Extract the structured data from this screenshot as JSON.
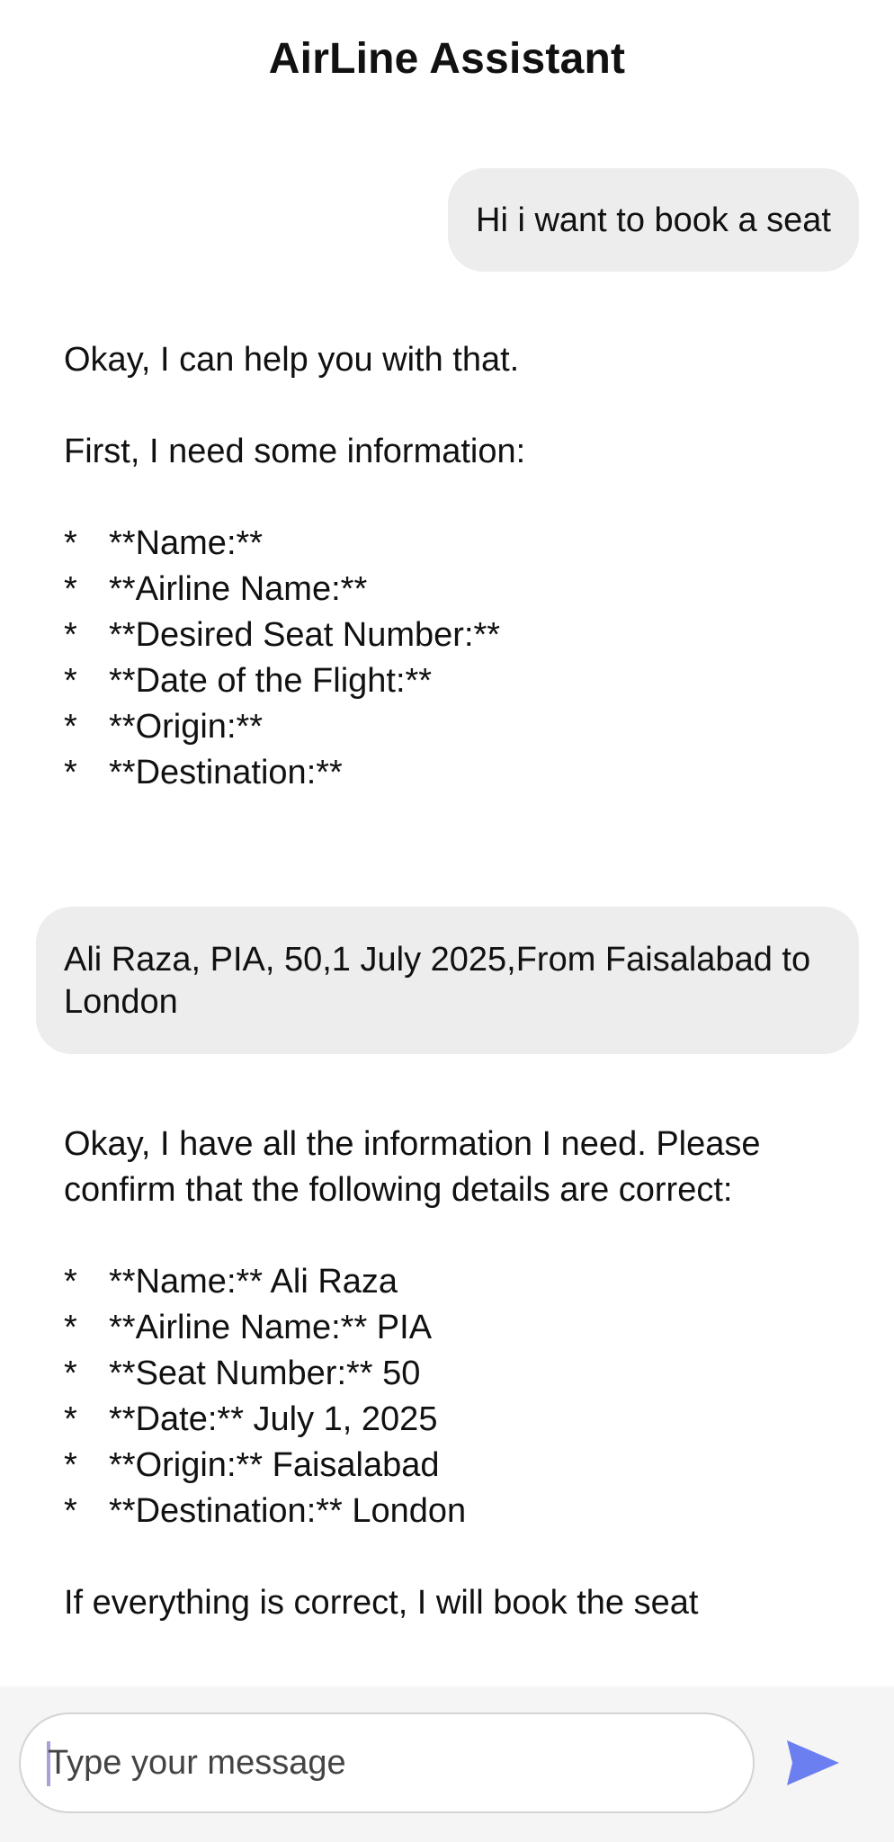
{
  "header": {
    "title": "AirLine Assistant"
  },
  "messages": {
    "user_1": "Hi i want to book a seat",
    "bot_1": {
      "intro": "Okay, I can help you with that.",
      "lead": "First, I need some information:",
      "bullet_symbol": "*",
      "items": [
        "**Name:**",
        "**Airline Name:**",
        "**Desired Seat Number:**",
        "**Date of the Flight:**",
        "**Origin:**",
        "**Destination:**"
      ]
    },
    "user_2": "Ali Raza, PIA, 50,1 July 2025,From Faisalabad to London",
    "bot_2": {
      "intro": "Okay, I have all the information I need. Please confirm that the following details are correct:",
      "bullet_symbol": "*",
      "items": [
        "**Name:** Ali Raza",
        "**Airline Name:** PIA",
        "**Seat Number:** 50",
        "**Date:** July 1, 2025",
        "**Origin:** Faisalabad",
        "**Destination:** London"
      ],
      "outro": "If everything is correct, I will book the seat"
    }
  },
  "composer": {
    "placeholder": "Type your message",
    "send_icon": "send-icon",
    "accent_color": "#6b7ff0"
  }
}
